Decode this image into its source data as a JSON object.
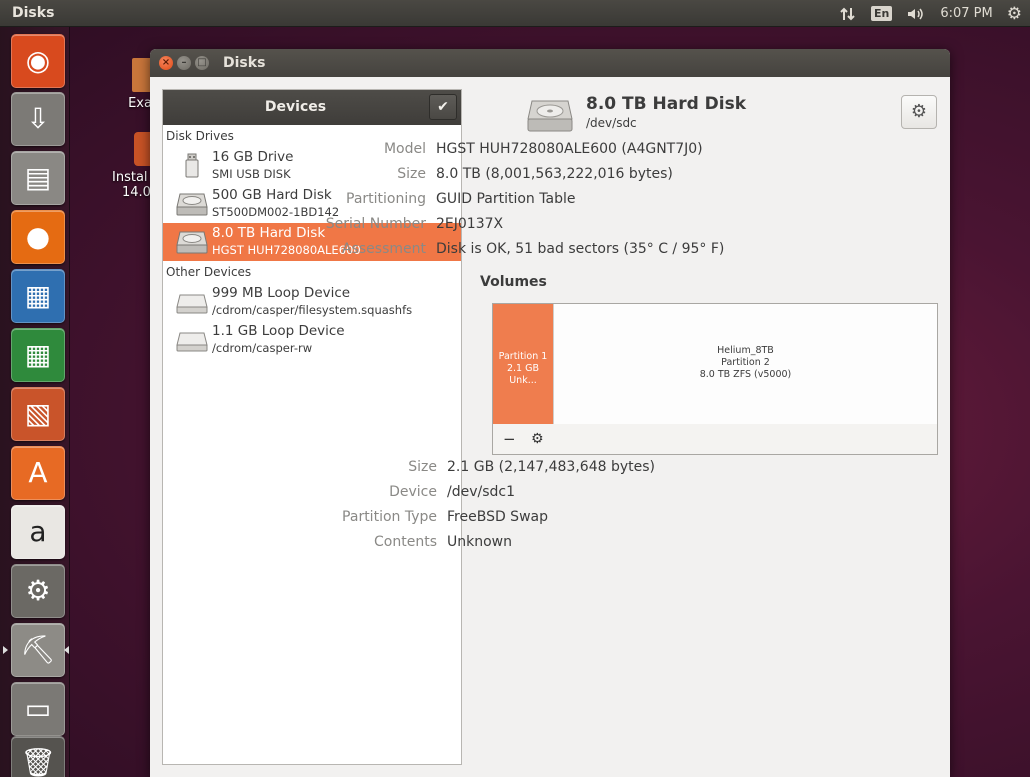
{
  "top_panel": {
    "app_title": "Disks",
    "lang": "En",
    "clock": "6:07 PM"
  },
  "launcher": {
    "items": [
      {
        "name": "ubuntu-dash-icon",
        "glyph": "◉",
        "bg": "#d84a1e"
      },
      {
        "name": "software-updater-icon",
        "glyph": "⇩",
        "bg": "#7c7a76"
      },
      {
        "name": "files-icon",
        "glyph": "▤",
        "bg": "#8a8884"
      },
      {
        "name": "firefox-icon",
        "glyph": "●",
        "bg": "#e56b12"
      },
      {
        "name": "libreoffice-writer-icon",
        "glyph": "▦",
        "bg": "#2f6fb0"
      },
      {
        "name": "libreoffice-calc-icon",
        "glyph": "▦",
        "bg": "#2f8a3c"
      },
      {
        "name": "libreoffice-impress-icon",
        "glyph": "▧",
        "bg": "#c9542a"
      },
      {
        "name": "ubuntu-software-center-icon",
        "glyph": "A",
        "bg": "#e76a24"
      },
      {
        "name": "amazon-icon",
        "glyph": "a",
        "bg": "#e9e7e3"
      },
      {
        "name": "system-settings-icon",
        "glyph": "⚙",
        "bg": "#6b6964"
      },
      {
        "name": "disks-app-icon",
        "glyph": "⛏",
        "bg": "#8d8b86"
      },
      {
        "name": "removable-drive-icon",
        "glyph": "▭",
        "bg": "#7b7975"
      },
      {
        "name": "trash-icon",
        "glyph": "🗑",
        "bg": "#55534f"
      }
    ]
  },
  "desktop": {
    "icon1_label": "Exa",
    "icon2_label_line1": "Instal",
    "icon2_label_line2": "14.0"
  },
  "window": {
    "title": "Disks",
    "close_glyph": "×",
    "min_glyph": "–",
    "max_glyph": "□"
  },
  "devices": {
    "header": "Devices",
    "check_glyph": "✔",
    "section_disk_drives": "Disk Drives",
    "section_other_devices": "Other Devices",
    "disk_drives": [
      {
        "name": "16 GB Drive",
        "sub": "SMI USB DISK",
        "type": "usb"
      },
      {
        "name": "500 GB Hard Disk",
        "sub": "ST500DM002-1BD142",
        "type": "hdd"
      },
      {
        "name": "8.0 TB Hard Disk",
        "sub": "HGST HUH728080ALE600",
        "type": "hdd",
        "selected": true
      }
    ],
    "other_devices": [
      {
        "name": "999 MB Loop Device",
        "sub": "/cdrom/casper/filesystem.squashfs",
        "type": "loop"
      },
      {
        "name": "1.1 GB Loop Device",
        "sub": "/cdrom/casper-rw",
        "type": "loop"
      }
    ]
  },
  "disk": {
    "title": "8.0 TB Hard Disk",
    "path": "/dev/sdc",
    "gear_glyph": "⚙",
    "properties": [
      {
        "label": "Model",
        "value": "HGST HUH728080ALE600 (A4GNT7J0)"
      },
      {
        "label": "Size",
        "value": "8.0 TB (8,001,563,222,016 bytes)"
      },
      {
        "label": "Partitioning",
        "value": "GUID Partition Table"
      },
      {
        "label": "Serial Number",
        "value": "2EJ0137X"
      },
      {
        "label": "Assessment",
        "value": "Disk is OK, 51 bad sectors (35° C / 95° F)"
      }
    ]
  },
  "volumes": {
    "label": "Volumes",
    "partition1": {
      "line1": "Partition 1",
      "line2": "2.1 GB Unk..."
    },
    "partition2": {
      "line1": "Helium_8TB",
      "line2": "Partition 2",
      "line3": "8.0 TB ZFS (v5000)"
    },
    "toolbar_minus": "−",
    "toolbar_gear": "⚙",
    "properties": [
      {
        "label": "Size",
        "value": "2.1 GB (2,147,483,648 bytes)"
      },
      {
        "label": "Device",
        "value": "/dev/sdc1"
      },
      {
        "label": "Partition Type",
        "value": "FreeBSD Swap"
      },
      {
        "label": "Contents",
        "value": "Unknown"
      }
    ]
  },
  "colors": {
    "accent": "#f07746",
    "panel": "#3c3b37"
  }
}
